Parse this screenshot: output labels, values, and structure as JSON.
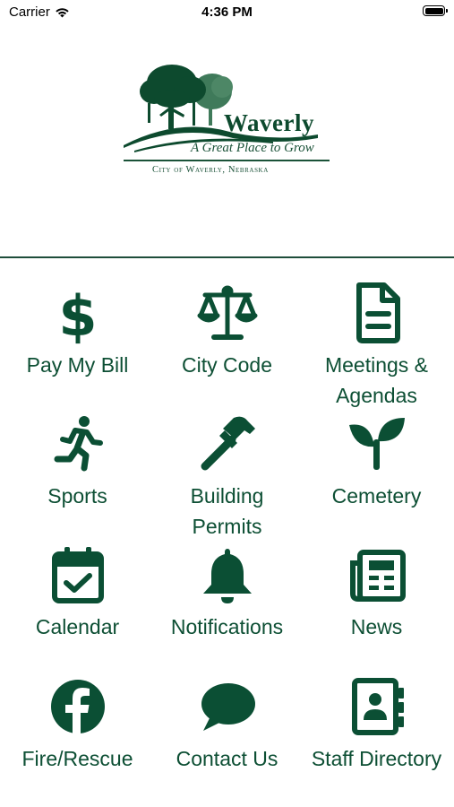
{
  "status_bar": {
    "carrier": "Carrier",
    "time": "4:36 PM"
  },
  "logo": {
    "title": "Waverly",
    "tagline": "A Great Place to Grow",
    "city_line": "City of Waverly, Nebraska"
  },
  "colors": {
    "accent": "#0b4f34",
    "divider": "#1e4d3a",
    "background": "#ffffff"
  },
  "menu": [
    {
      "label": "Pay My Bill",
      "icon": "dollar-icon"
    },
    {
      "label": "City Code",
      "icon": "scale-icon"
    },
    {
      "label": "Meetings &\nAgendas",
      "icon": "document-icon"
    },
    {
      "label": "Sports",
      "icon": "running-icon"
    },
    {
      "label": "Building\nPermits",
      "icon": "hammer-icon"
    },
    {
      "label": "Cemetery",
      "icon": "seedling-icon"
    },
    {
      "label": "Calendar",
      "icon": "calendar-check-icon"
    },
    {
      "label": "Notifications",
      "icon": "bell-icon"
    },
    {
      "label": "News",
      "icon": "newspaper-icon"
    },
    {
      "label": "Fire/Rescue",
      "icon": "facebook-icon"
    },
    {
      "label": "Contact Us",
      "icon": "chat-bubble-icon"
    },
    {
      "label": "Staff Directory",
      "icon": "address-book-icon"
    }
  ]
}
